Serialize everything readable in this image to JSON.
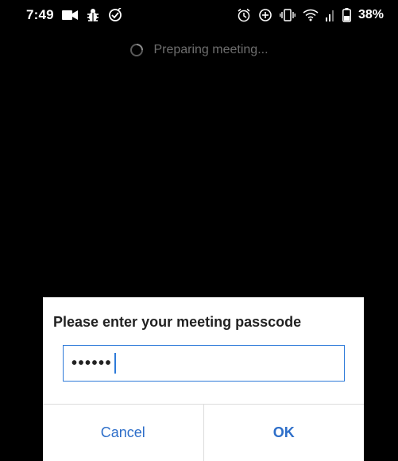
{
  "status_bar": {
    "time": "7:49",
    "battery": "38%",
    "left_icons": [
      "video-camera-icon",
      "bug-icon",
      "check-badge-icon"
    ],
    "right_icons": [
      "alarm-icon",
      "data-saver-icon",
      "vibrate-icon",
      "wifi-icon",
      "signal-icon",
      "battery-icon"
    ]
  },
  "loading": {
    "text": "Preparing meeting..."
  },
  "dialog": {
    "title": "Please enter your meeting passcode",
    "passcode_masked": "••••••",
    "cancel_label": "Cancel",
    "ok_label": "OK"
  },
  "colors": {
    "accent": "#2d6ec9",
    "background": "#000000",
    "dialog_bg": "#ffffff"
  }
}
